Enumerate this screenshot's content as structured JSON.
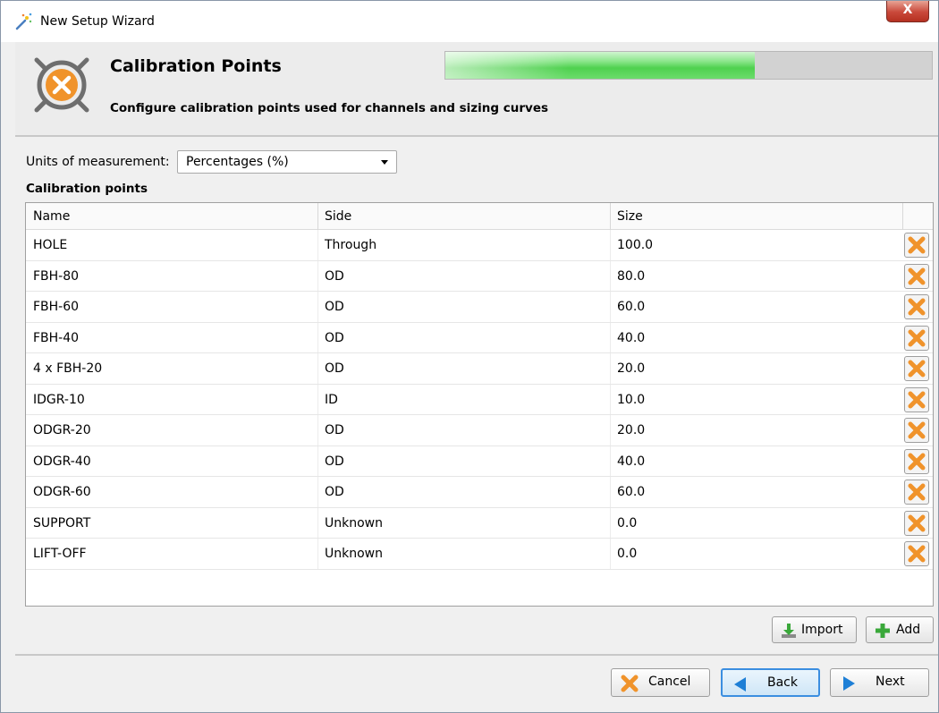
{
  "window": {
    "title": "New Setup Wizard",
    "close_label": "X"
  },
  "header": {
    "title": "Calibration Points",
    "subtitle": "Configure calibration points used for channels and sizing curves",
    "progress": 0.636
  },
  "units": {
    "label": "Units of measurement:",
    "selected": "Percentages (%)"
  },
  "section_label": "Calibration points",
  "table": {
    "columns": [
      "Name",
      "Side",
      "Size"
    ],
    "rows": [
      {
        "name": "HOLE",
        "side": "Through",
        "size": "100.0"
      },
      {
        "name": "FBH-80",
        "side": "OD",
        "size": "80.0"
      },
      {
        "name": "FBH-60",
        "side": "OD",
        "size": "60.0"
      },
      {
        "name": "FBH-40",
        "side": "OD",
        "size": "40.0"
      },
      {
        "name": "4 x FBH-20",
        "side": "OD",
        "size": "20.0"
      },
      {
        "name": "IDGR-10",
        "side": "ID",
        "size": "10.0"
      },
      {
        "name": "ODGR-20",
        "side": "OD",
        "size": "20.0"
      },
      {
        "name": "ODGR-40",
        "side": "OD",
        "size": "40.0"
      },
      {
        "name": "ODGR-60",
        "side": "OD",
        "size": "60.0"
      },
      {
        "name": "SUPPORT",
        "side": "Unknown",
        "size": "0.0"
      },
      {
        "name": "LIFT-OFF",
        "side": "Unknown",
        "size": "0.0"
      }
    ]
  },
  "actions": {
    "import_label": "Import",
    "add_label": "Add"
  },
  "footer": {
    "cancel_label": "Cancel",
    "back_label": "Back",
    "next_label": "Next"
  },
  "colors": {
    "accent_orange": "#f0932b",
    "progress_green": "#4fd14f",
    "back_blue": "#3b8ee0"
  }
}
